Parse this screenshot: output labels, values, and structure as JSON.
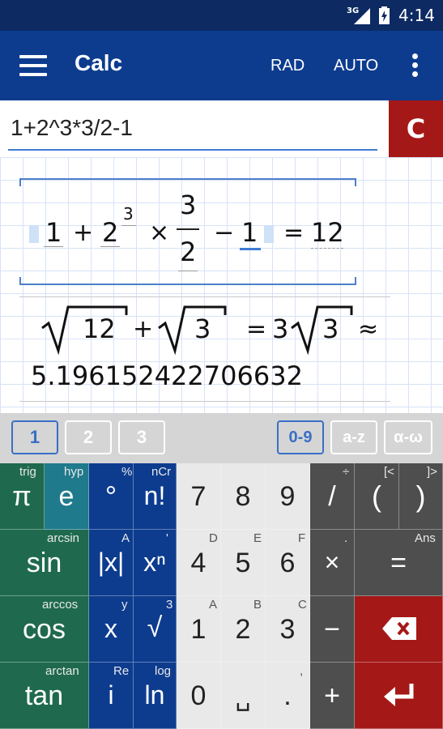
{
  "status": {
    "network": "3G",
    "time": "4:14"
  },
  "appbar": {
    "title": "Calc",
    "angle_mode": "RAD",
    "format_mode": "AUTO"
  },
  "input": {
    "expression": "1+2^3*3/2-1",
    "clear_label": "C"
  },
  "results": {
    "expr1": {
      "t1": "1",
      "plus": "+",
      "base": "2",
      "exp": "3",
      "times": "×",
      "num": "3",
      "den": "2",
      "minus": "−",
      "t2": "1",
      "eq": "=",
      "result": "12"
    },
    "expr2": {
      "rad1": "12",
      "plus": "+",
      "rad2": "3",
      "eq": "=",
      "coef": "3",
      "rad3": "3",
      "approx": "≈",
      "decimal": "5.196152422706632"
    }
  },
  "keyboard_tabs": [
    "1",
    "2",
    "3",
    "0-9",
    "a-z",
    "α-ω"
  ],
  "keys": {
    "pi": {
      "sup": "trig",
      "main": "π"
    },
    "e": {
      "sup": "hyp",
      "main": "e"
    },
    "deg": {
      "sup": "%",
      "main": "°"
    },
    "fact": {
      "sup": "nCr",
      "main": "n!"
    },
    "sin": {
      "sup": "arcsin",
      "main": "sin"
    },
    "abs": {
      "sup": "A",
      "main": "|x|"
    },
    "pow": {
      "sup": "'",
      "main": "xⁿ"
    },
    "cos": {
      "sup": "arccos",
      "main": "cos"
    },
    "x": {
      "sup": "y",
      "main": "x"
    },
    "sqrt": {
      "sup": "3",
      "main": "√"
    },
    "tan": {
      "sup": "arctan",
      "main": "tan"
    },
    "i": {
      "sup": "Re",
      "main": "i"
    },
    "ln": {
      "sup": "log",
      "main": "ln"
    },
    "d7": {
      "sup": "",
      "main": "7"
    },
    "d8": {
      "sup": "",
      "main": "8"
    },
    "d9": {
      "sup": "",
      "main": "9"
    },
    "d4": {
      "sup": "D",
      "main": "4"
    },
    "d5": {
      "sup": "E",
      "main": "5"
    },
    "d6": {
      "sup": "F",
      "main": "6"
    },
    "d1": {
      "sup": "A",
      "main": "1"
    },
    "d2": {
      "sup": "B",
      "main": "2"
    },
    "d3": {
      "sup": "C",
      "main": "3"
    },
    "d0": {
      "sup": "",
      "main": "0"
    },
    "space": {
      "sup": "",
      "main": "␣"
    },
    "dot": {
      "sup": ",",
      "main": "."
    },
    "div": {
      "sup": "÷",
      "main": "/"
    },
    "lparen": {
      "sup": "[<",
      "main": "("
    },
    "rparen": {
      "sup": "]>",
      "main": ")"
    },
    "mul": {
      "sup": ".",
      "main": "×"
    },
    "eq": {
      "sup": "Ans",
      "main": "="
    },
    "sub": {
      "sup": "",
      "main": "−"
    },
    "add": {
      "sup": "",
      "main": "+"
    }
  },
  "colors": {
    "appbar": "#0d3c8f",
    "statusbar": "#0d2a63",
    "clear": "#a51818",
    "green": "#1f6a4f",
    "teal": "#1f7a8c",
    "blue": "#0d3c8f"
  }
}
